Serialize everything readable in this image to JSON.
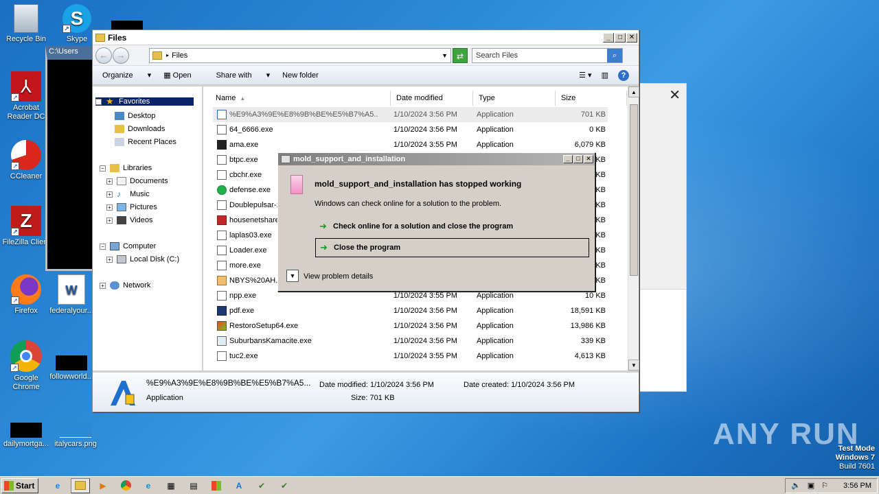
{
  "desktop": {
    "icons": [
      {
        "label": "Recycle Bin"
      },
      {
        "label": "Skype"
      },
      {
        "label": "Acrobat Reader DC"
      },
      {
        "label": "CCleaner"
      },
      {
        "label": "FileZilla Client"
      },
      {
        "label": "Firefox"
      },
      {
        "label": "federalyour..."
      },
      {
        "label": "Google Chrome"
      },
      {
        "label": "followworld..."
      },
      {
        "label": "dailymortga..."
      },
      {
        "label": "italycars.png"
      }
    ],
    "cmd_title": "C:\\Users"
  },
  "explorer": {
    "title": "Files",
    "address_path": "Files",
    "search_placeholder": "Search Files",
    "toolbar": {
      "organize": "Organize",
      "open": "Open",
      "share_with": "Share with",
      "new_folder": "New folder"
    },
    "nav": {
      "favorites": "Favorites",
      "desktop": "Desktop",
      "downloads": "Downloads",
      "recent_places": "Recent Places",
      "libraries": "Libraries",
      "documents": "Documents",
      "music": "Music",
      "pictures": "Pictures",
      "videos": "Videos",
      "computer": "Computer",
      "local_disk": "Local Disk (C:)",
      "network": "Network"
    },
    "columns": {
      "name": "Name",
      "date": "Date modified",
      "type": "Type",
      "size": "Size"
    },
    "files": [
      {
        "name": "%E9%A3%9E%E8%9B%BE%E5%B7%A5...",
        "date": "1/10/2024 3:56 PM",
        "type": "Application",
        "size": "701 KB"
      },
      {
        "name": "64_6666.exe",
        "date": "1/10/2024 3:56 PM",
        "type": "Application",
        "size": "0 KB"
      },
      {
        "name": "ama.exe",
        "date": "1/10/2024 3:55 PM",
        "type": "Application",
        "size": "6,079 KB"
      },
      {
        "name": "btpc.exe",
        "date": "",
        "type": "",
        "size": "KB"
      },
      {
        "name": "cbchr.exe",
        "date": "",
        "type": "",
        "size": "KB"
      },
      {
        "name": "defense.exe",
        "date": "",
        "type": "",
        "size": "KB"
      },
      {
        "name": "Doublepulsar-1",
        "date": "",
        "type": "",
        "size": "KB"
      },
      {
        "name": "housenetshare",
        "date": "",
        "type": "",
        "size": "KB"
      },
      {
        "name": "laplas03.exe",
        "date": "",
        "type": "",
        "size": "KB"
      },
      {
        "name": "Loader.exe",
        "date": "",
        "type": "",
        "size": "KB"
      },
      {
        "name": "more.exe",
        "date": "",
        "type": "",
        "size": "KB"
      },
      {
        "name": "NBYS%20AH.N",
        "date": "",
        "type": "",
        "size": "KB"
      },
      {
        "name": "npp.exe",
        "date": "1/10/2024 3:55 PM",
        "type": "Application",
        "size": "10 KB"
      },
      {
        "name": "pdf.exe",
        "date": "1/10/2024 3:56 PM",
        "type": "Application",
        "size": "18,591 KB"
      },
      {
        "name": "RestoroSetup64.exe",
        "date": "1/10/2024 3:56 PM",
        "type": "Application",
        "size": "13,986 KB"
      },
      {
        "name": "SuburbansKamacite.exe",
        "date": "1/10/2024 3:56 PM",
        "type": "Application",
        "size": "339 KB"
      },
      {
        "name": "tuc2.exe",
        "date": "1/10/2024 3:55 PM",
        "type": "Application",
        "size": "4,613 KB"
      }
    ],
    "details": {
      "name": "%E9%A3%9E%E8%9B%BE%E5%B7%A5...",
      "type": "Application",
      "date_modified": "Date modified: 1/10/2024 3:56 PM",
      "size": "Size: 701 KB",
      "date_created": "Date created: 1/10/2024 3:56 PM"
    }
  },
  "dialog": {
    "title": "mold_support_and_installation",
    "heading": "mold_support_and_installation has stopped working",
    "message": "Windows can check online for a solution to the problem.",
    "option_check": "Check online for a solution and close the program",
    "option_close": "Close the program",
    "details": "View problem details"
  },
  "watermark": {
    "brand": "ANY RUN",
    "test_mode": "Test Mode",
    "os": "Windows 7",
    "build": "Build 7601"
  },
  "taskbar": {
    "start": "Start",
    "clock": "3:56 PM"
  }
}
